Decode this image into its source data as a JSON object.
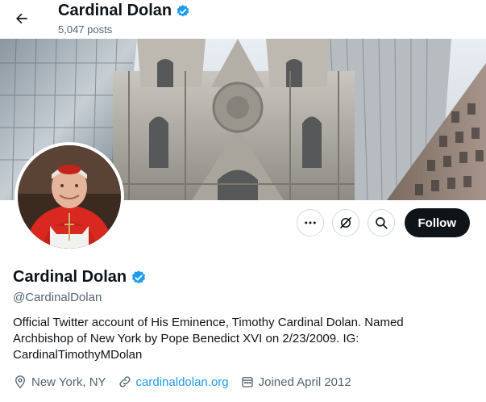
{
  "header": {
    "title": "Cardinal Dolan",
    "posts": "5,047 posts"
  },
  "profile": {
    "name": "Cardinal Dolan",
    "handle": "@CardinalDolan",
    "bio": "Official Twitter account of His Eminence, Timothy Cardinal Dolan. Named Archbishop of New York by Pope Benedict XVI on 2/23/2009. IG: CardinalTimothyMDolan",
    "location": "New York, NY",
    "website": "cardinaldolan.org",
    "joined": "Joined April 2012"
  },
  "actions": {
    "follow_label": "Follow"
  },
  "colors": {
    "accent": "#1d9bf0",
    "text": "#0f1419",
    "muted": "#536471",
    "follow_bg": "#0f1419"
  },
  "icons": [
    "back-arrow-icon",
    "verified-badge-icon",
    "more-icon",
    "grok-icon",
    "search-icon",
    "location-icon",
    "link-icon",
    "calendar-icon"
  ]
}
